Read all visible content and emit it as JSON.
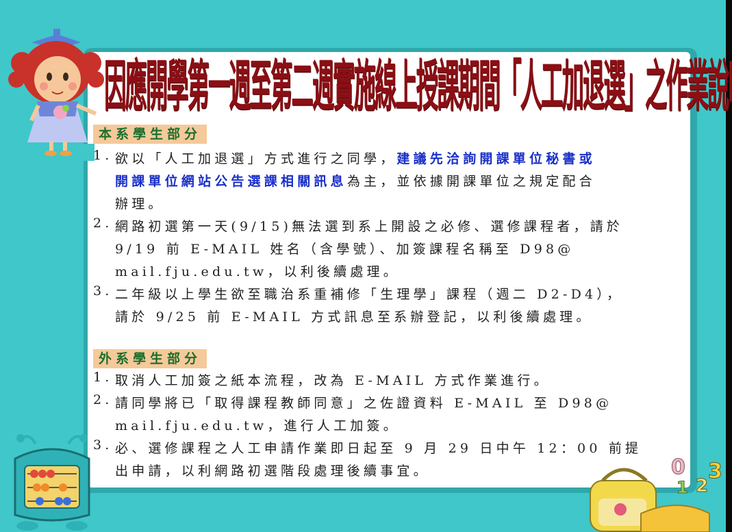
{
  "title": "因應開學第一週至第二週實施線上授課期間「人工加退選」之作業說明",
  "section1": {
    "label": "本系學生部分",
    "items": [
      {
        "num": "1.",
        "lines": [
          [
            "欲以「人工加退選」方式進行之同學，",
            "建議先洽詢開課單位秘書或"
          ],
          [
            "開課單位網站公告選課相關訊息",
            "為主，並依據開課單位之規定配合"
          ],
          [
            "辦理。",
            ""
          ]
        ]
      },
      {
        "num": "2.",
        "lines": [
          "網路初選第一天(9/15)無法選到系上開設之必修、選修課程者，請於",
          "9/19 前 E-MAIL 姓名（含學號）、加簽課程名稱至 D98@",
          "mail.fju.edu.tw，以利後續處理。"
        ]
      },
      {
        "num": "3.",
        "lines": [
          "二年級以上學生欲至職治系重補修「生理學」課程（週二 D2-D4），",
          "請於 9/25 前 E-MAIL 方式訊息至系辦登記，以利後續處理。"
        ]
      }
    ]
  },
  "section2": {
    "label": "外系學生部分",
    "items": [
      {
        "num": "1.",
        "lines": [
          "取消人工加簽之紙本流程，改為 E-MAIL 方式作業進行。"
        ]
      },
      {
        "num": "2.",
        "lines": [
          "請同學將已「取得課程教師同意」之佐證資料 E-MAIL 至 D98@",
          "mail.fju.edu.tw，進行人工加簽。"
        ]
      },
      {
        "num": "3.",
        "lines": [
          "必、選修課程之人工申請作業即日起至 9 月 29 日中午 12：00 前提",
          "出申請，以利網路初選階段處理後續事宜。"
        ]
      }
    ]
  },
  "decorations": {
    "numbers_clip": [
      "0",
      "1",
      "2",
      "3"
    ]
  },
  "colors": {
    "background": "#3fc7c9",
    "title": "#8b0f14",
    "label_bg": "#f5c99a",
    "label_text": "#1c6e2c",
    "highlight": "#1a2fc9"
  }
}
